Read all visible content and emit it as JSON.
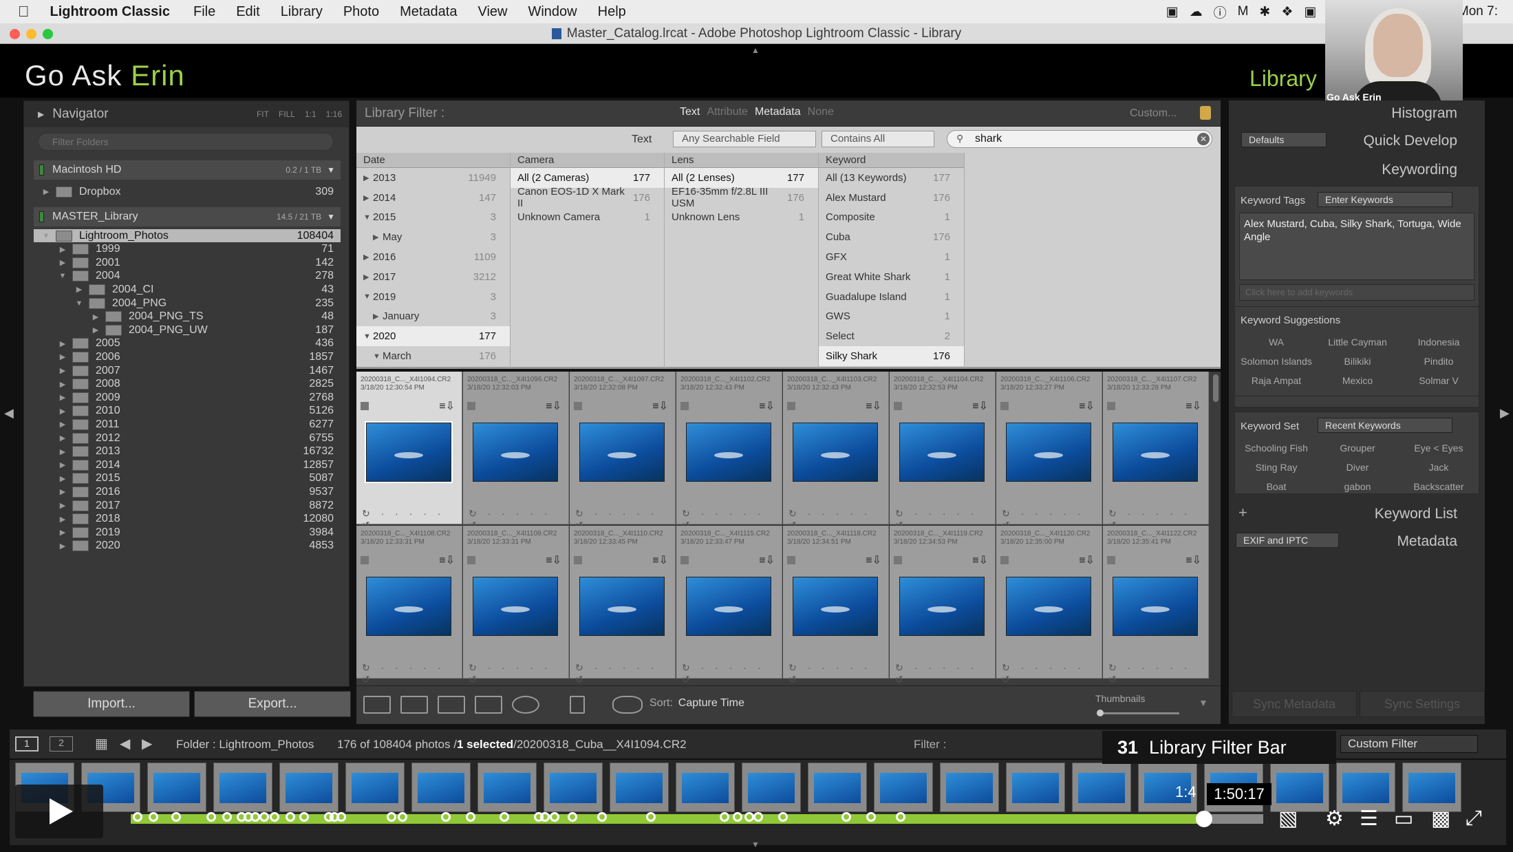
{
  "menubar": {
    "app": "Lightroom Classic",
    "items": [
      "File",
      "Edit",
      "Library",
      "Photo",
      "Metadata",
      "View",
      "Window",
      "Help"
    ],
    "clock": "Mon 7:"
  },
  "window": {
    "title": "Master_Catalog.lrcat - Adobe Photoshop Lightroom Classic - Library"
  },
  "identity": {
    "brand_a": "Go Ask ",
    "brand_b": "Erin",
    "module": "Library"
  },
  "webcam": {
    "label": "Go Ask Erin"
  },
  "left_panel": {
    "navigator": "Navigator",
    "nav_zoom": [
      "FIT",
      "FILL",
      "1:1",
      "1:16"
    ],
    "search_placeholder": "Filter Folders",
    "volumes": [
      {
        "name": "Macintosh HD",
        "cap": "0.2 / 1 TB"
      },
      {
        "name": "MASTER_Library",
        "cap": "14.5 / 21 TB"
      }
    ],
    "dropbox": {
      "name": "Dropbox",
      "count": "309"
    },
    "folders": [
      {
        "name": "Lightroom_Photos",
        "count": "108404",
        "lvl": 0,
        "open": true,
        "sel": true
      },
      {
        "name": "1999",
        "count": "71",
        "lvl": 1
      },
      {
        "name": "2001",
        "count": "142",
        "lvl": 1
      },
      {
        "name": "2004",
        "count": "278",
        "lvl": 1,
        "open": true
      },
      {
        "name": "2004_CI",
        "count": "43",
        "lvl": 2
      },
      {
        "name": "2004_PNG",
        "count": "235",
        "lvl": 2,
        "open": true
      },
      {
        "name": "2004_PNG_TS",
        "count": "48",
        "lvl": 3
      },
      {
        "name": "2004_PNG_UW",
        "count": "187",
        "lvl": 3
      },
      {
        "name": "2005",
        "count": "436",
        "lvl": 1
      },
      {
        "name": "2006",
        "count": "1857",
        "lvl": 1
      },
      {
        "name": "2007",
        "count": "1467",
        "lvl": 1
      },
      {
        "name": "2008",
        "count": "2825",
        "lvl": 1
      },
      {
        "name": "2009",
        "count": "2768",
        "lvl": 1
      },
      {
        "name": "2010",
        "count": "5126",
        "lvl": 1
      },
      {
        "name": "2011",
        "count": "6277",
        "lvl": 1
      },
      {
        "name": "2012",
        "count": "6755",
        "lvl": 1
      },
      {
        "name": "2013",
        "count": "16732",
        "lvl": 1
      },
      {
        "name": "2014",
        "count": "12857",
        "lvl": 1
      },
      {
        "name": "2015",
        "count": "5087",
        "lvl": 1
      },
      {
        "name": "2016",
        "count": "9537",
        "lvl": 1
      },
      {
        "name": "2017",
        "count": "8872",
        "lvl": 1
      },
      {
        "name": "2018",
        "count": "12080",
        "lvl": 1
      },
      {
        "name": "2019",
        "count": "3984",
        "lvl": 1
      },
      {
        "name": "2020",
        "count": "4853",
        "lvl": 1
      }
    ],
    "import_label": "Import...",
    "export_label": "Export..."
  },
  "filter_bar": {
    "title": "Library Filter :",
    "tabs": [
      "Text",
      "Attribute",
      "Metadata",
      "None"
    ],
    "custom": "Custom...",
    "text_label": "Text",
    "field": "Any Searchable Field",
    "rule": "Contains All",
    "query": "shark"
  },
  "metadata": {
    "columns": [
      {
        "header": "Date",
        "rows": [
          {
            "t": "▶",
            "l": "2013",
            "c": "11949"
          },
          {
            "t": "▶",
            "l": "2014",
            "c": "147"
          },
          {
            "t": "▼",
            "l": "2015",
            "c": "3"
          },
          {
            "t": "▶",
            "l": "May",
            "c": "3",
            "sub": true
          },
          {
            "t": "▶",
            "l": "2016",
            "c": "1109"
          },
          {
            "t": "▶",
            "l": "2017",
            "c": "3212"
          },
          {
            "t": "▼",
            "l": "2019",
            "c": "3"
          },
          {
            "t": "▶",
            "l": "January",
            "c": "3",
            "sub": true
          },
          {
            "t": "▼",
            "l": "2020",
            "c": "177",
            "sel": true
          },
          {
            "t": "▼",
            "l": "March",
            "c": "176",
            "sub": true
          }
        ]
      },
      {
        "header": "Camera",
        "rows": [
          {
            "l": "All (2 Cameras)",
            "c": "177",
            "sel": true
          },
          {
            "l": "Canon EOS-1D X Mark II",
            "c": "176"
          },
          {
            "l": "Unknown Camera",
            "c": "1"
          }
        ]
      },
      {
        "header": "Lens",
        "rows": [
          {
            "l": "All (2 Lenses)",
            "c": "177",
            "sel": true
          },
          {
            "l": "EF16-35mm f/2.8L III USM",
            "c": "176"
          },
          {
            "l": "Unknown Lens",
            "c": "1"
          }
        ]
      },
      {
        "header": "Keyword",
        "rows": [
          {
            "l": "All (13 Keywords)",
            "c": "177"
          },
          {
            "l": "Alex Mustard",
            "c": "176"
          },
          {
            "l": "Composite",
            "c": "1"
          },
          {
            "l": "Cuba",
            "c": "176"
          },
          {
            "l": "GFX",
            "c": "1"
          },
          {
            "l": "Great White Shark",
            "c": "1"
          },
          {
            "l": "Guadalupe Island",
            "c": "1"
          },
          {
            "l": "GWS",
            "c": "1"
          },
          {
            "l": "Select",
            "c": "2"
          },
          {
            "l": "Silky Shark",
            "c": "176",
            "sel": true
          }
        ]
      }
    ]
  },
  "grid": {
    "rows": [
      [
        {
          "f": "20200318_C..._X4I1094.CR2",
          "d": "3/18/20 12:30:54 PM",
          "sel": true
        },
        {
          "f": "20200318_C..._X4I1096.CR2",
          "d": "3/18/20 12:32:03 PM"
        },
        {
          "f": "20200318_C..._X4I1097.CR2",
          "d": "3/18/20 12:32:08 PM"
        },
        {
          "f": "20200318_C..._X4I1102.CR2",
          "d": "3/18/20 12:32:43 PM"
        },
        {
          "f": "20200318_C..._X4I1103.CR2",
          "d": "3/18/20 12:32:43 PM"
        },
        {
          "f": "20200318_C..._X4I1104.CR2",
          "d": "3/18/20 12:32:53 PM"
        },
        {
          "f": "20200318_C..._X4I1106.CR2",
          "d": "3/18/20 12:33:27 PM"
        },
        {
          "f": "20200318_C..._X4I1107.CR2",
          "d": "3/18/20 12:33:28 PM"
        }
      ],
      [
        {
          "f": "20200318_C..._X4I1108.CR2",
          "d": "3/18/20 12:33:31 PM"
        },
        {
          "f": "20200318_C..._X4I1109.CR2",
          "d": "3/18/20 12:33:31 PM"
        },
        {
          "f": "20200318_C..._X4I1110.CR2",
          "d": "3/18/20 12:33:45 PM"
        },
        {
          "f": "20200318_C..._X4I1115.CR2",
          "d": "3/18/20 12:33:47 PM"
        },
        {
          "f": "20200318_C..._X4I1118.CR2",
          "d": "3/18/20 12:34:51 PM"
        },
        {
          "f": "20200318_C..._X4I1119.CR2",
          "d": "3/18/20 12:34:53 PM"
        },
        {
          "f": "20200318_C..._X4I1120.CR2",
          "d": "3/18/20 12:35:00 PM"
        },
        {
          "f": "20200318_C..._X4I1122.CR2",
          "d": "3/18/20 12:35:41 PM"
        }
      ]
    ]
  },
  "toolbar": {
    "sort_label": "Sort:",
    "sort_value": "Capture Time",
    "thumbnails": "Thumbnails"
  },
  "right_panel": {
    "histogram": "Histogram",
    "defaults": "Defaults",
    "quick_develop": "Quick Develop",
    "keywording": "Keywording",
    "keyword_tags_label": "Keyword Tags",
    "keyword_tags_mode": "Enter Keywords",
    "keyword_text": "Alex Mustard, Cuba, Silky Shark, Tortuga, Wide Angle",
    "add_keywords_placeholder": "Click here to add keywords",
    "suggestions_label": "Keyword Suggestions",
    "suggestions": [
      "WA",
      "Little Cayman",
      "Indonesia",
      "Solomon Islands",
      "Bilikiki",
      "Pindito",
      "Raja Ampat",
      "Mexico",
      "Solmar V"
    ],
    "keyword_set_label": "Keyword Set",
    "keyword_set_value": "Recent Keywords",
    "set_keywords": [
      "Schooling Fish",
      "Grouper",
      "Eye < Eyes",
      "Sting Ray",
      "Diver",
      "Jack",
      "Boat",
      "gabon",
      "Backscatter"
    ],
    "keyword_list": "Keyword List",
    "metadata_preset": "EXIF and IPTC",
    "metadata": "Metadata",
    "sync_metadata": "Sync Metadata",
    "sync_settings": "Sync Settings"
  },
  "filmstrip": {
    "screens": [
      "1",
      "2"
    ],
    "path": "Folder : Lightroom_Photos",
    "count_a": "176 of 108404 photos /",
    "count_b": "1 selected",
    "count_c": "/20200318_Cuba__X4I1094.CR2",
    "filter_label": "Filter :",
    "filter_value": "Custom Filter",
    "frame_count": 22
  },
  "video": {
    "chapter_num": "31",
    "chapter_title": "Library Filter Bar",
    "time_partial": "1:4",
    "time_tip": "1:50:17",
    "progress_fraction": 0.948,
    "markers": [
      0.006,
      0.02,
      0.04,
      0.071,
      0.085,
      0.098,
      0.104,
      0.11,
      0.118,
      0.127,
      0.141,
      0.153,
      0.175,
      0.18,
      0.186,
      0.23,
      0.24,
      0.278,
      0.3,
      0.33,
      0.36,
      0.366,
      0.374,
      0.39,
      0.416,
      0.459,
      0.524,
      0.536,
      0.546,
      0.554,
      0.576,
      0.632,
      0.654,
      0.68
    ]
  },
  "colors": {
    "accent": "#9bd14a",
    "progress": "#90c838",
    "panel": "#383838",
    "grid_cell": "#9d9d9d",
    "selected_cell": "#d9d9d9"
  }
}
